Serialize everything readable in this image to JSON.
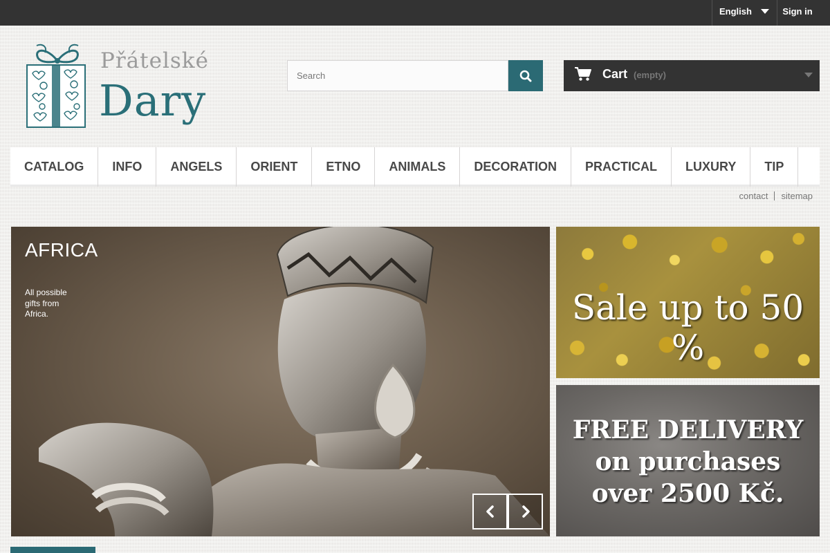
{
  "topbar": {
    "language": "English",
    "signin": "Sign in"
  },
  "logo": {
    "line1": "Přátelské",
    "line2": "Dary"
  },
  "search": {
    "placeholder": "Search"
  },
  "cart": {
    "label": "Cart",
    "status": "(empty)"
  },
  "nav": {
    "items": [
      "CATALOG",
      "INFO",
      "ANGELS",
      "ORIENT",
      "ETNO",
      "ANIMALS",
      "DECORATION",
      "PRACTICAL",
      "LUXURY",
      "TIP"
    ]
  },
  "links": {
    "contact": "contact",
    "sitemap": "sitemap"
  },
  "slider": {
    "title": "AFRICA",
    "description": "All possible gifts from Africa."
  },
  "banners": {
    "sale": "Sale up to 50 %",
    "delivery_line1": "FREE DELIVERY",
    "delivery_line2": "on purchases",
    "delivery_line3": "over 2500 Kč."
  },
  "colors": {
    "accent": "#2b6a74",
    "topbar": "#333333",
    "nav_text": "#484848"
  }
}
